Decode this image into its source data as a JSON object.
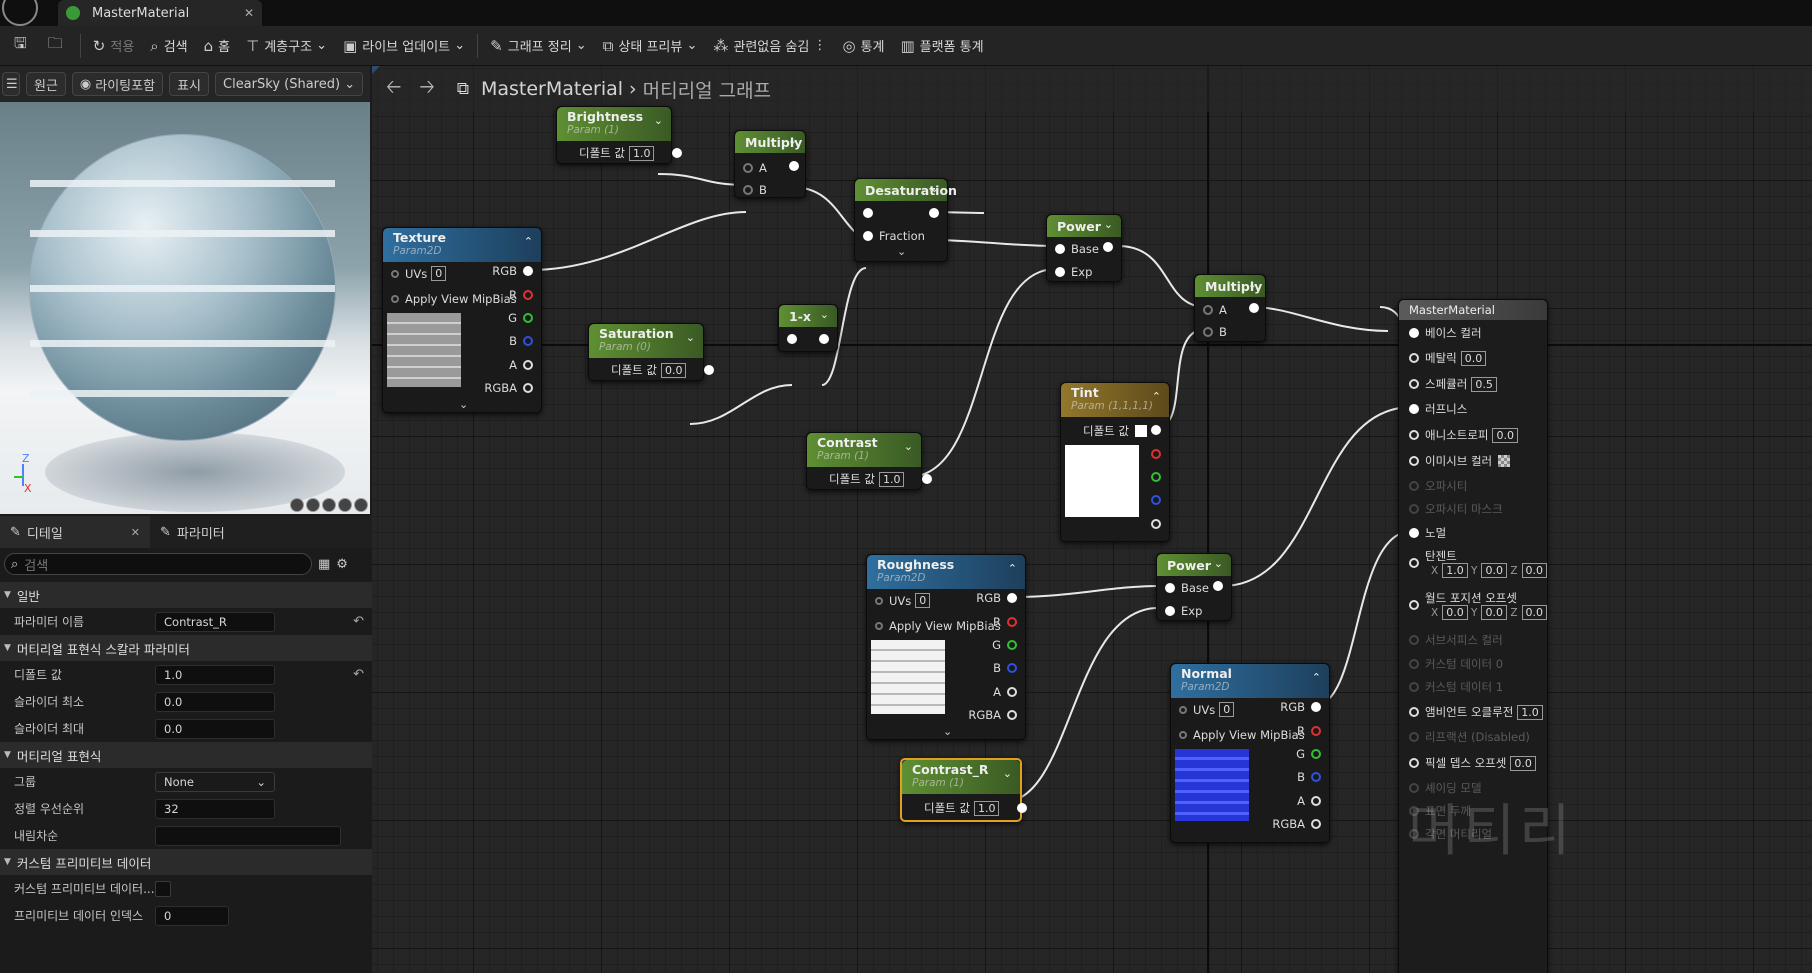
{
  "window": {
    "tab_title": "MasterMaterial",
    "tab_close": "✕"
  },
  "toolbar": {
    "apply": "적용",
    "search": "검색",
    "home": "홈",
    "hierarchy": "계층구조",
    "live_update": "라이브 업데이트",
    "graph_cleanup": "그래프 정리",
    "state_preview": "상태 프리뷰",
    "hide_unrelated": "관련없음 숨김",
    "stats": "통계",
    "platform_stats": "플랫폼 통계"
  },
  "viewport": {
    "perspective": "원근",
    "lighting": "라이팅포함",
    "show": "표시",
    "sky": "ClearSky (Shared)",
    "gizmo_z": "Z",
    "gizmo_x": "X"
  },
  "details": {
    "tab_details": "디테일",
    "tab_params": "파라미터",
    "search_placeholder": "검색",
    "sec_general": "일반",
    "param_name_label": "파라미터 이름",
    "param_name_value": "Contrast_R",
    "sec_scalar": "머티리얼 표현식 스칼라 파라미터",
    "default_label": "디폴트 값",
    "default_value": "1.0",
    "slider_min_label": "슬라이더 최소",
    "slider_min_value": "0.0",
    "slider_max_label": "슬라이더 최대",
    "slider_max_value": "0.0",
    "sec_expr": "머티리얼 표현식",
    "group_label": "그룹",
    "group_value": "None",
    "priority_label": "정렬 우선순위",
    "priority_value": "32",
    "desc_label": "내림차순",
    "desc_value": "",
    "sec_custom": "커스텀 프리미티브 데이터",
    "custom_label": "커스텀 프리미티브 데이터...",
    "index_label": "프리미티브 데이터 인덱스",
    "index_value": "0"
  },
  "graph": {
    "breadcrumb_root": "MasterMaterial",
    "breadcrumb_sub": "머티리얼 그래프",
    "watermark": "머티리",
    "brightness": {
      "title": "Brightness",
      "sub": "Param (1)",
      "default_label": "디폴트 값",
      "value": "1.0"
    },
    "saturation": {
      "title": "Saturation",
      "sub": "Param (0)",
      "default_label": "디폴트 값",
      "value": "0.0"
    },
    "contrast": {
      "title": "Contrast",
      "sub": "Param (1)",
      "default_label": "디폴트 값",
      "value": "1.0"
    },
    "contrast_r": {
      "title": "Contrast_R",
      "sub": "Param (1)",
      "default_label": "디폴트 값",
      "value": "1.0"
    },
    "tint": {
      "title": "Tint",
      "sub": "Param (1,1,1,1)",
      "default_label": "디폴트 값"
    },
    "multiply1": {
      "title": "Multiply",
      "a": "A",
      "b": "B"
    },
    "multiply2": {
      "title": "Multiply",
      "a": "A",
      "b": "B"
    },
    "desat": {
      "title": "Desaturation",
      "fraction": "Fraction"
    },
    "oneminus": {
      "title": "1-x"
    },
    "power1": {
      "title": "Power",
      "base": "Base",
      "exp": "Exp"
    },
    "power2": {
      "title": "Power",
      "base": "Base",
      "exp": "Exp"
    },
    "texture": {
      "title": "Texture",
      "sub": "Param2D",
      "uvs": "UVs",
      "uvs_val": "0",
      "mip": "Apply View MipBias",
      "rgb": "RGB",
      "r": "R",
      "g": "G",
      "b": "B",
      "a": "A",
      "rgba": "RGBA"
    },
    "roughness": {
      "title": "Roughness",
      "sub": "Param2D",
      "uvs": "UVs",
      "uvs_val": "0",
      "mip": "Apply View MipBias",
      "rgb": "RGB",
      "r": "R",
      "g": "G",
      "b": "B",
      "a": "A",
      "rgba": "RGBA"
    },
    "normal": {
      "title": "Normal",
      "sub": "Param2D",
      "uvs": "UVs",
      "uvs_val": "0",
      "mip": "Apply View MipBias",
      "rgb": "RGB",
      "r": "R",
      "g": "G",
      "b": "B",
      "a": "A",
      "rgba": "RGBA"
    },
    "master": {
      "title": "MasterMaterial",
      "base_color": "베이스 컬러",
      "metallic": "메탈릭",
      "metallic_v": "0.0",
      "specular": "스페큘러",
      "specular_v": "0.5",
      "roughness": "러프니스",
      "aniso": "애니소트로피",
      "aniso_v": "0.0",
      "emissive": "이미시브 컬러",
      "opacity": "오파시티",
      "opacity_mask": "오파시티 마스크",
      "normal": "노멀",
      "tangent": "탄젠트",
      "tx": "X",
      "tx_v": "1.0",
      "ty": "Y",
      "ty_v": "0.0",
      "tz": "Z",
      "tz_v": "0.0",
      "wpo": "월드 포지션 오프셋",
      "wx": "X",
      "wx_v": "0.0",
      "wy": "Y",
      "wy_v": "0.0",
      "wz": "Z",
      "wz_v": "0.0",
      "subsurface": "서브서피스 컬러",
      "custom0": "커스텀 데이터 0",
      "custom1": "커스텀 데이터 1",
      "ao": "앰비언트 오클루전",
      "ao_v": "1.0",
      "refraction": "리프랙션 (Disabled)",
      "pdo": "픽셀 뎁스 오프셋",
      "pdo_v": "0.0",
      "shading": "셰이딩 모델",
      "front": "표면 두께",
      "displace": "각면 머티리얼"
    }
  }
}
